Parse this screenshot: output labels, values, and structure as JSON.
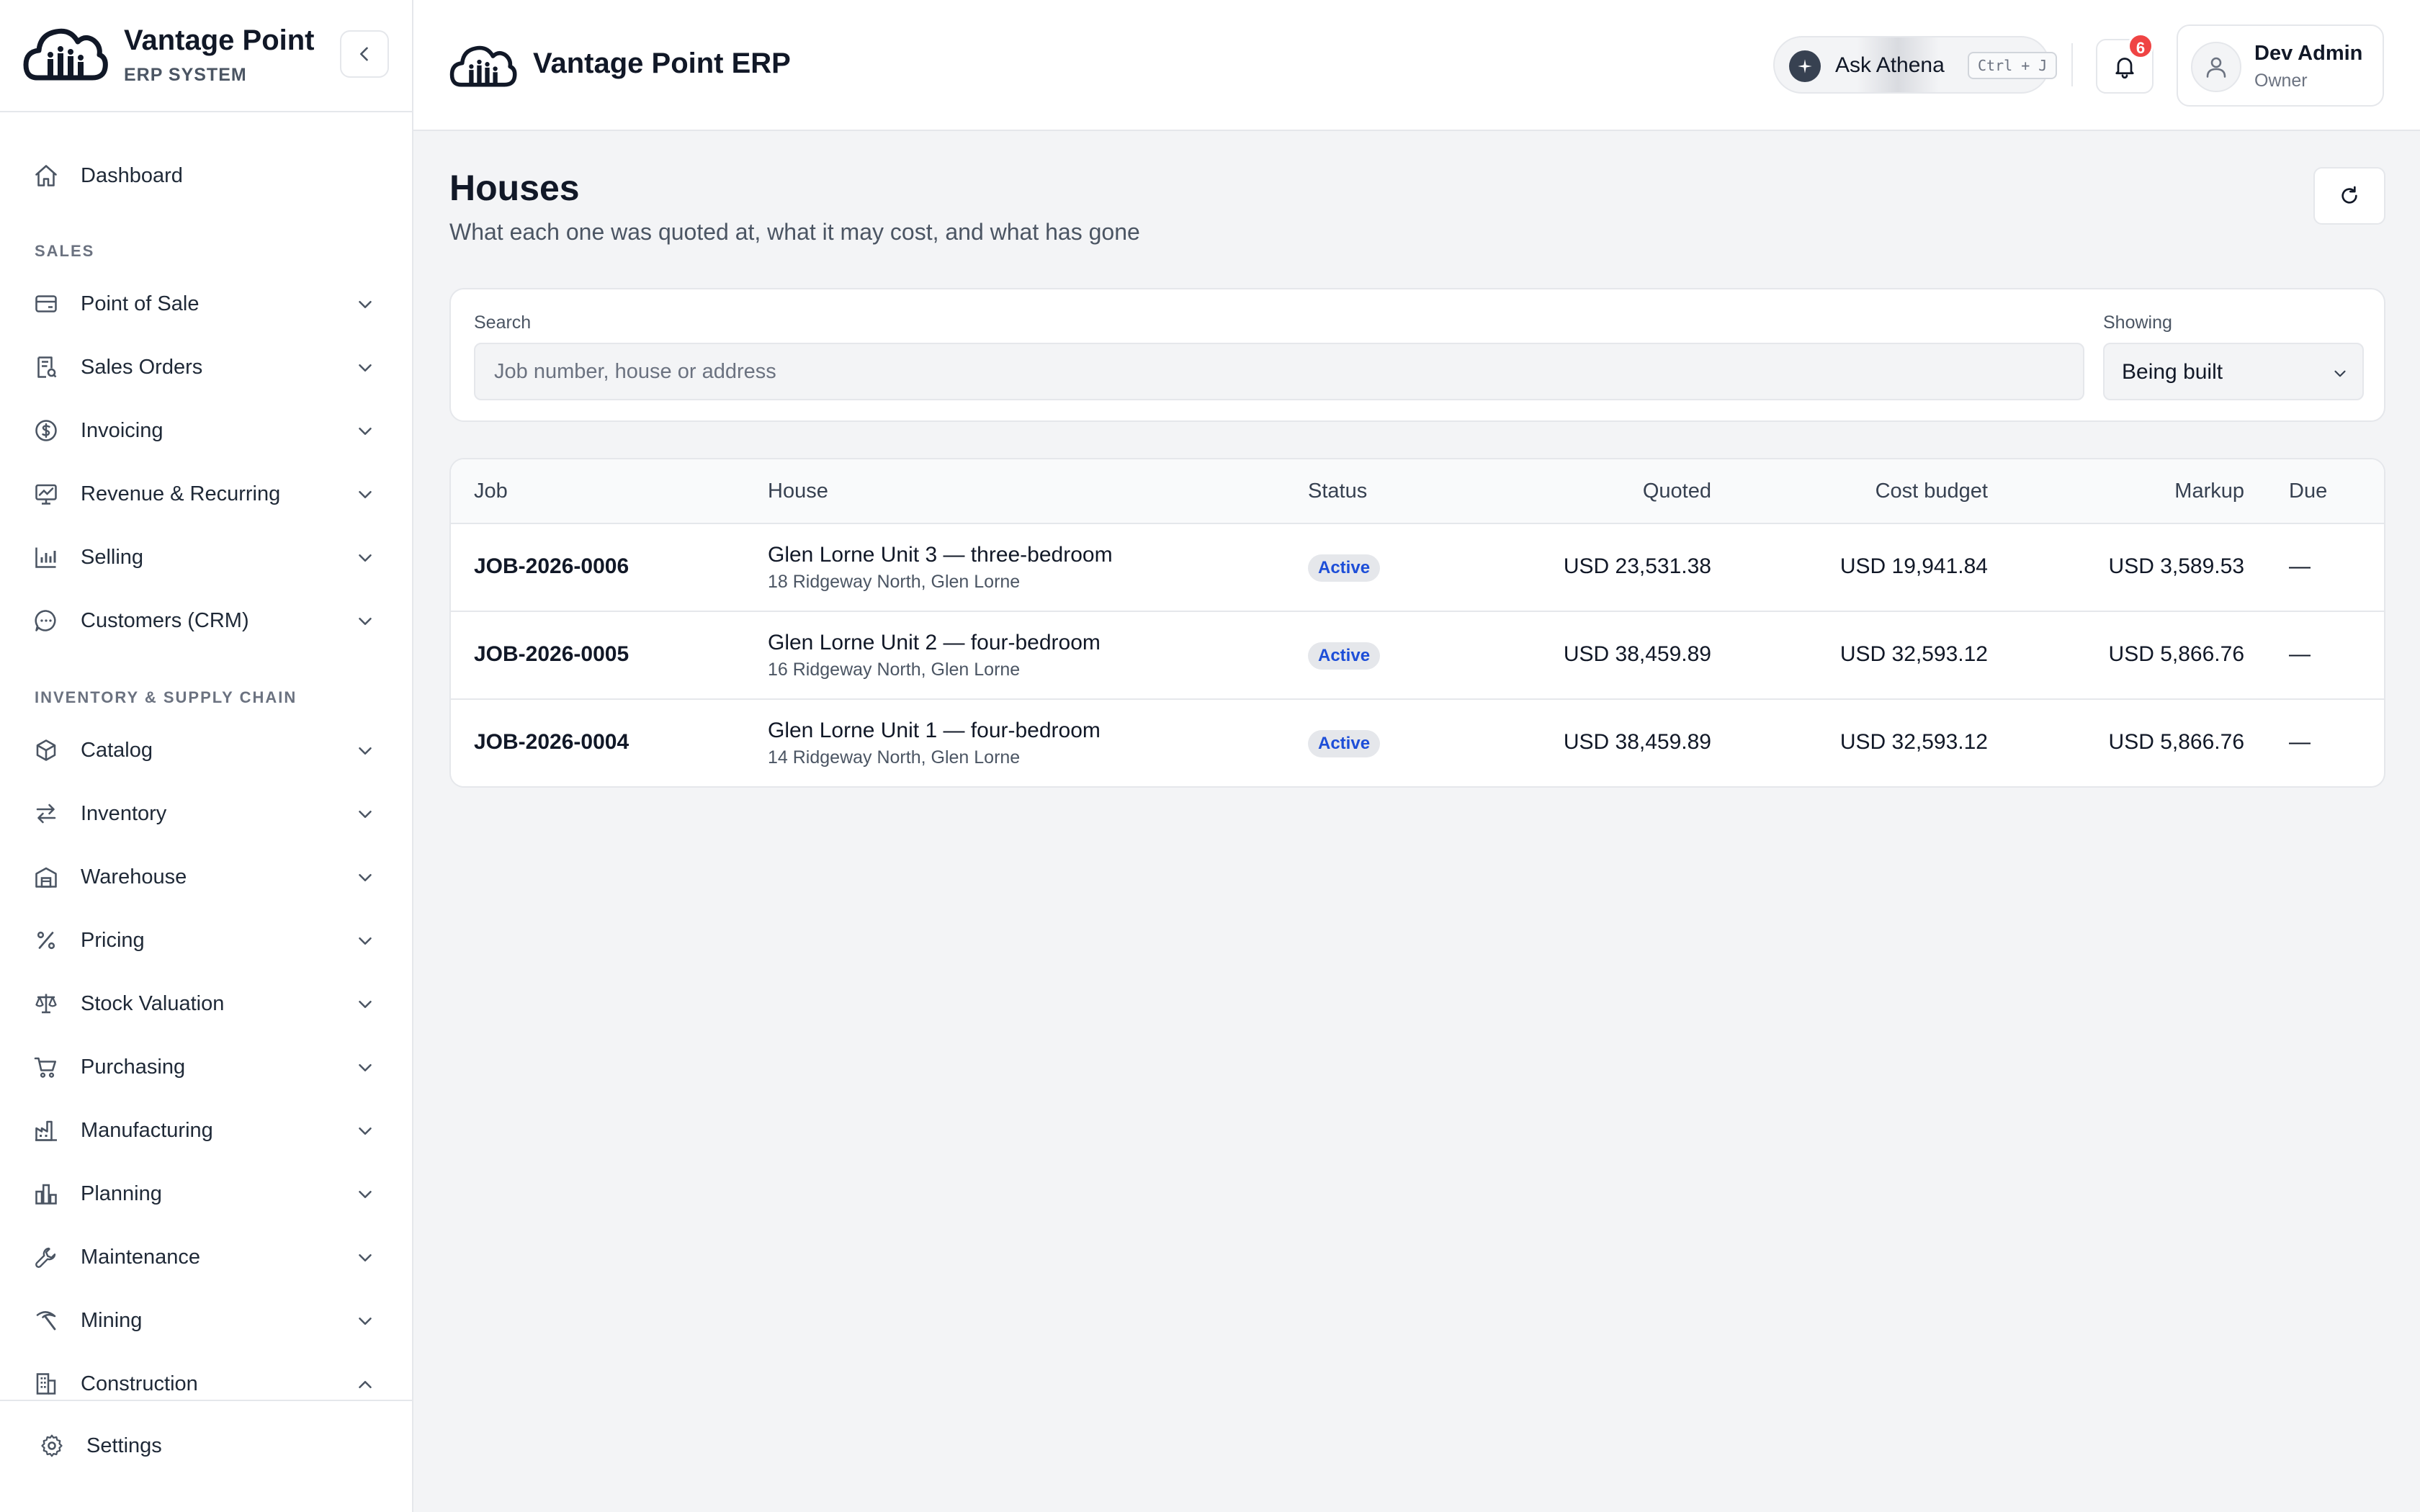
{
  "brand": {
    "name": "Vantage Point",
    "subtitle": "ERP SYSTEM"
  },
  "sidebar": {
    "dashboard": "Dashboard",
    "sections": [
      {
        "title": "SALES",
        "items": [
          {
            "label": "Point of Sale",
            "icon": "card-icon",
            "expanded": false
          },
          {
            "label": "Sales Orders",
            "icon": "receipt-icon",
            "expanded": false
          },
          {
            "label": "Invoicing",
            "icon": "dollar-circle-icon",
            "expanded": false
          },
          {
            "label": "Revenue & Recurring",
            "icon": "chart-monitor-icon",
            "expanded": false
          },
          {
            "label": "Selling",
            "icon": "bar-chart-icon",
            "expanded": false
          },
          {
            "label": "Customers (CRM)",
            "icon": "chat-bubble-icon",
            "expanded": false
          }
        ]
      },
      {
        "title": "INVENTORY & SUPPLY CHAIN",
        "items": [
          {
            "label": "Catalog",
            "icon": "box-icon",
            "expanded": false
          },
          {
            "label": "Inventory",
            "icon": "arrows-swap-icon",
            "expanded": false
          },
          {
            "label": "Warehouse",
            "icon": "warehouse-icon",
            "expanded": false
          },
          {
            "label": "Pricing",
            "icon": "percent-icon",
            "expanded": false
          },
          {
            "label": "Stock Valuation",
            "icon": "scale-icon",
            "expanded": false
          },
          {
            "label": "Purchasing",
            "icon": "cart-icon",
            "expanded": false
          },
          {
            "label": "Manufacturing",
            "icon": "factory-icon",
            "expanded": false
          },
          {
            "label": "Planning",
            "icon": "bar-columns-icon",
            "expanded": false
          },
          {
            "label": "Maintenance",
            "icon": "wrench-icon",
            "expanded": false
          },
          {
            "label": "Mining",
            "icon": "pickaxe-icon",
            "expanded": false
          },
          {
            "label": "Construction",
            "icon": "building-icon",
            "expanded": true
          }
        ]
      }
    ],
    "settings": "Settings"
  },
  "topbar": {
    "title": "Vantage Point ERP",
    "ask_label": "Ask Athena",
    "ask_shortcut": "Ctrl + J",
    "notifications_count": "6",
    "user_name": "Dev Admin",
    "user_role": "Owner"
  },
  "page": {
    "title": "Houses",
    "subtitle": "What each one was quoted at, what it may cost, and what has gone"
  },
  "filters": {
    "search_label": "Search",
    "search_placeholder": "Job number, house or address",
    "search_value": "",
    "showing_label": "Showing",
    "showing_value": "Being built"
  },
  "table": {
    "headers": {
      "job": "Job",
      "house": "House",
      "status": "Status",
      "quoted": "Quoted",
      "cost_budget": "Cost budget",
      "markup": "Markup",
      "due": "Due"
    },
    "rows": [
      {
        "job": "JOB-2026-0006",
        "house": "Glen Lorne Unit 3 — three-bedroom",
        "address": "18 Ridgeway North, Glen Lorne",
        "status": "Active",
        "quoted": "USD 23,531.38",
        "cost_budget": "USD 19,941.84",
        "markup": "USD 3,589.53",
        "due": "—"
      },
      {
        "job": "JOB-2026-0005",
        "house": "Glen Lorne Unit 2 — four-bedroom",
        "address": "16 Ridgeway North, Glen Lorne",
        "status": "Active",
        "quoted": "USD 38,459.89",
        "cost_budget": "USD 32,593.12",
        "markup": "USD 5,866.76",
        "due": "—"
      },
      {
        "job": "JOB-2026-0004",
        "house": "Glen Lorne Unit 1 — four-bedroom",
        "address": "14 Ridgeway North, Glen Lorne",
        "status": "Active",
        "quoted": "USD 38,459.89",
        "cost_budget": "USD 32,593.12",
        "markup": "USD 5,866.76",
        "due": "—"
      }
    ]
  },
  "colors": {
    "accent_blue": "#1d4ed8",
    "badge_bg": "#e5e7eb",
    "notification_red": "#ef4444",
    "page_bg": "#f3f4f6"
  }
}
